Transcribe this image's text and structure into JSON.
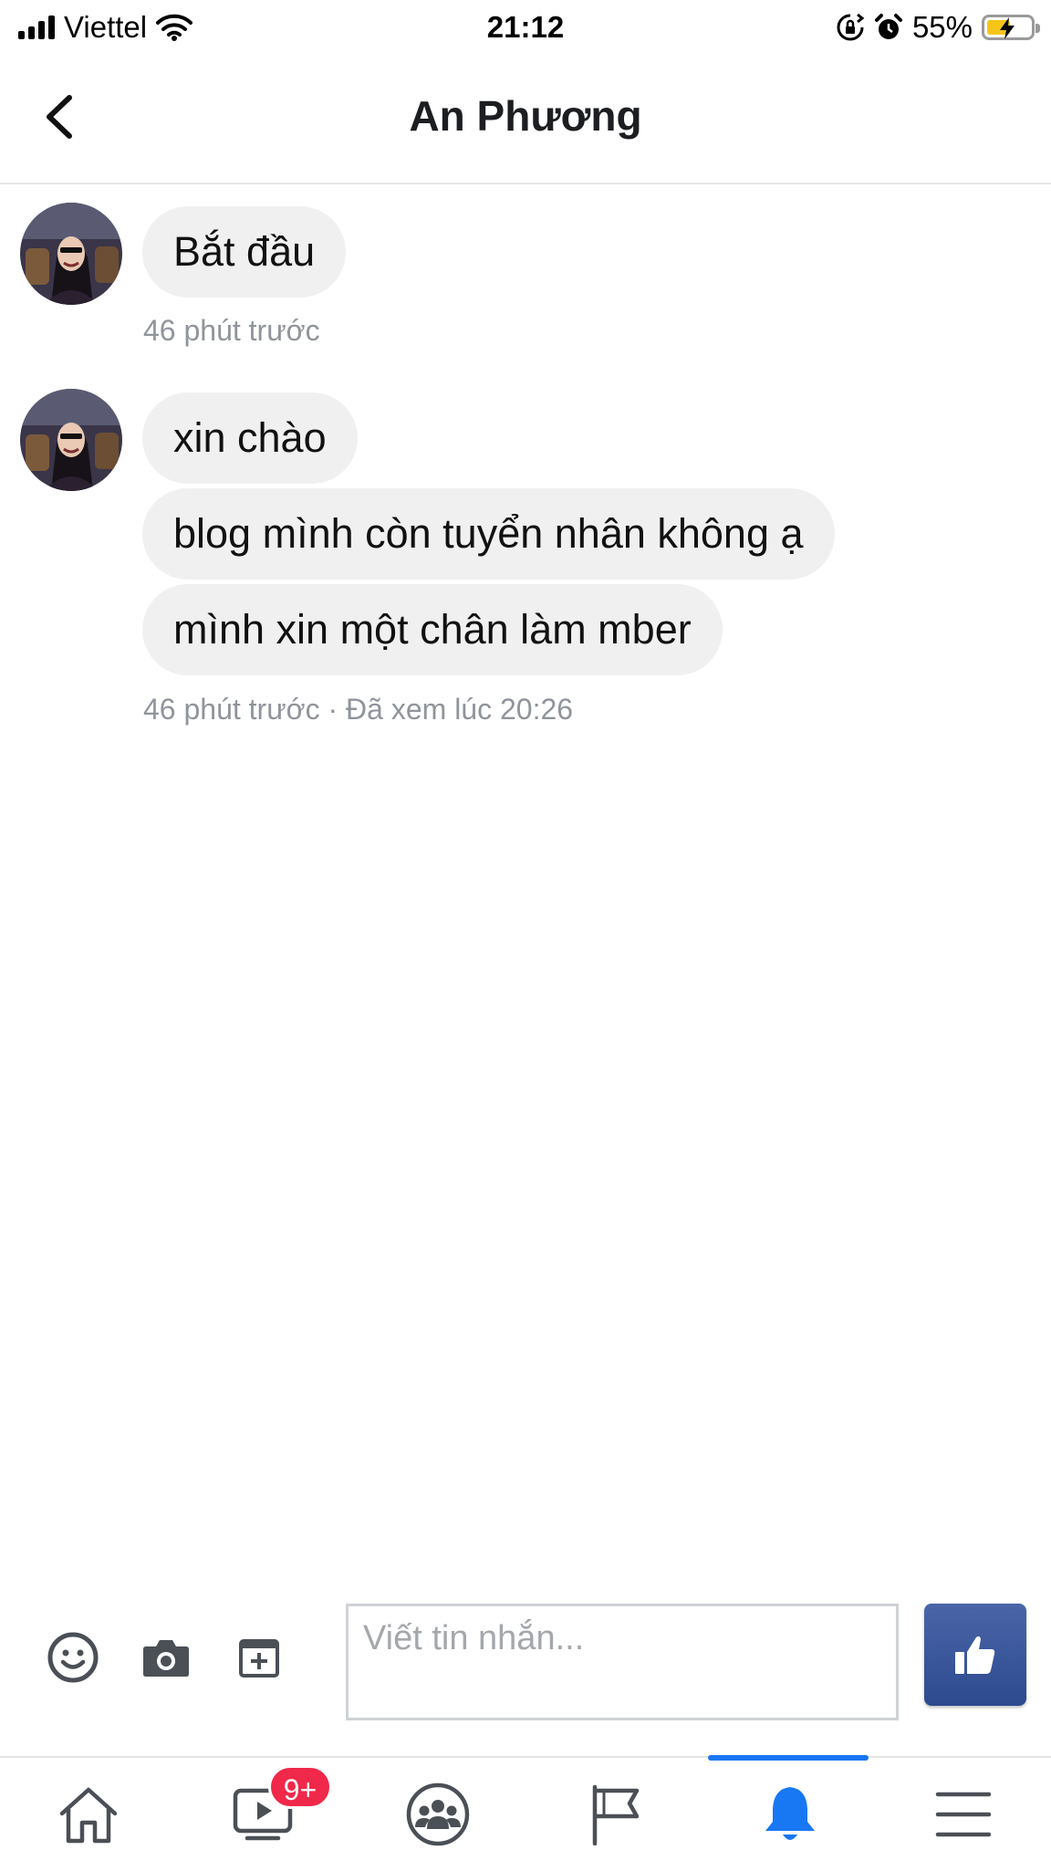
{
  "status_bar": {
    "carrier": "Viettel",
    "time": "21:12",
    "battery_percent": "55%",
    "battery_level": 0.55,
    "icons": [
      "signal-icon",
      "wifi-icon",
      "rotation-lock-icon",
      "alarm-icon",
      "battery-charging-icon"
    ]
  },
  "header": {
    "title": "An Phương",
    "back_icon": "chevron-left-icon"
  },
  "conversation": {
    "groups": [
      {
        "messages": [
          "Bắt đầu"
        ],
        "meta": "46 phút trước"
      },
      {
        "messages": [
          "xin chào",
          "blog mình còn tuyển nhân không ạ",
          "mình xin một chân làm mber"
        ],
        "meta": "46 phút trước · Đã xem lúc 20:26"
      }
    ]
  },
  "composer": {
    "placeholder": "Viết tin nhắn...",
    "value": "",
    "icons": [
      "emoji-icon",
      "camera-icon",
      "sticker-icon",
      "thumbs-up-icon"
    ]
  },
  "bottom_nav": {
    "tabs": [
      "home-icon",
      "watch-icon",
      "groups-icon",
      "pages-icon",
      "notifications-icon",
      "menu-icon"
    ],
    "active": "notifications-icon",
    "watch_badge": "9+"
  },
  "colors": {
    "accent": "#1877f2",
    "bubble": "#f0f0f0",
    "meta_text": "#90949c",
    "like_button": "#3b5998",
    "badge": "#f02849"
  }
}
